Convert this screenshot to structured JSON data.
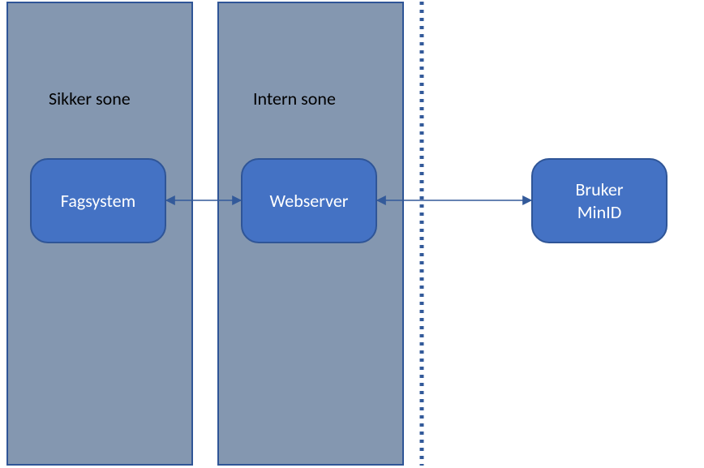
{
  "zones": {
    "sikker": {
      "label": "Sikker sone"
    },
    "intern": {
      "label": "Intern sone"
    }
  },
  "nodes": {
    "fagsystem": {
      "label": "Fagsystem"
    },
    "webserver": {
      "label": "Webserver"
    },
    "bruker": {
      "line1": "Bruker",
      "line2": "MinID"
    }
  },
  "colors": {
    "zone_fill": "#8497b0",
    "zone_border": "#2f5597",
    "node_fill": "#4472c4",
    "node_border": "#2f5597",
    "arrow": "#335a9a",
    "divider": "#335a9a"
  }
}
